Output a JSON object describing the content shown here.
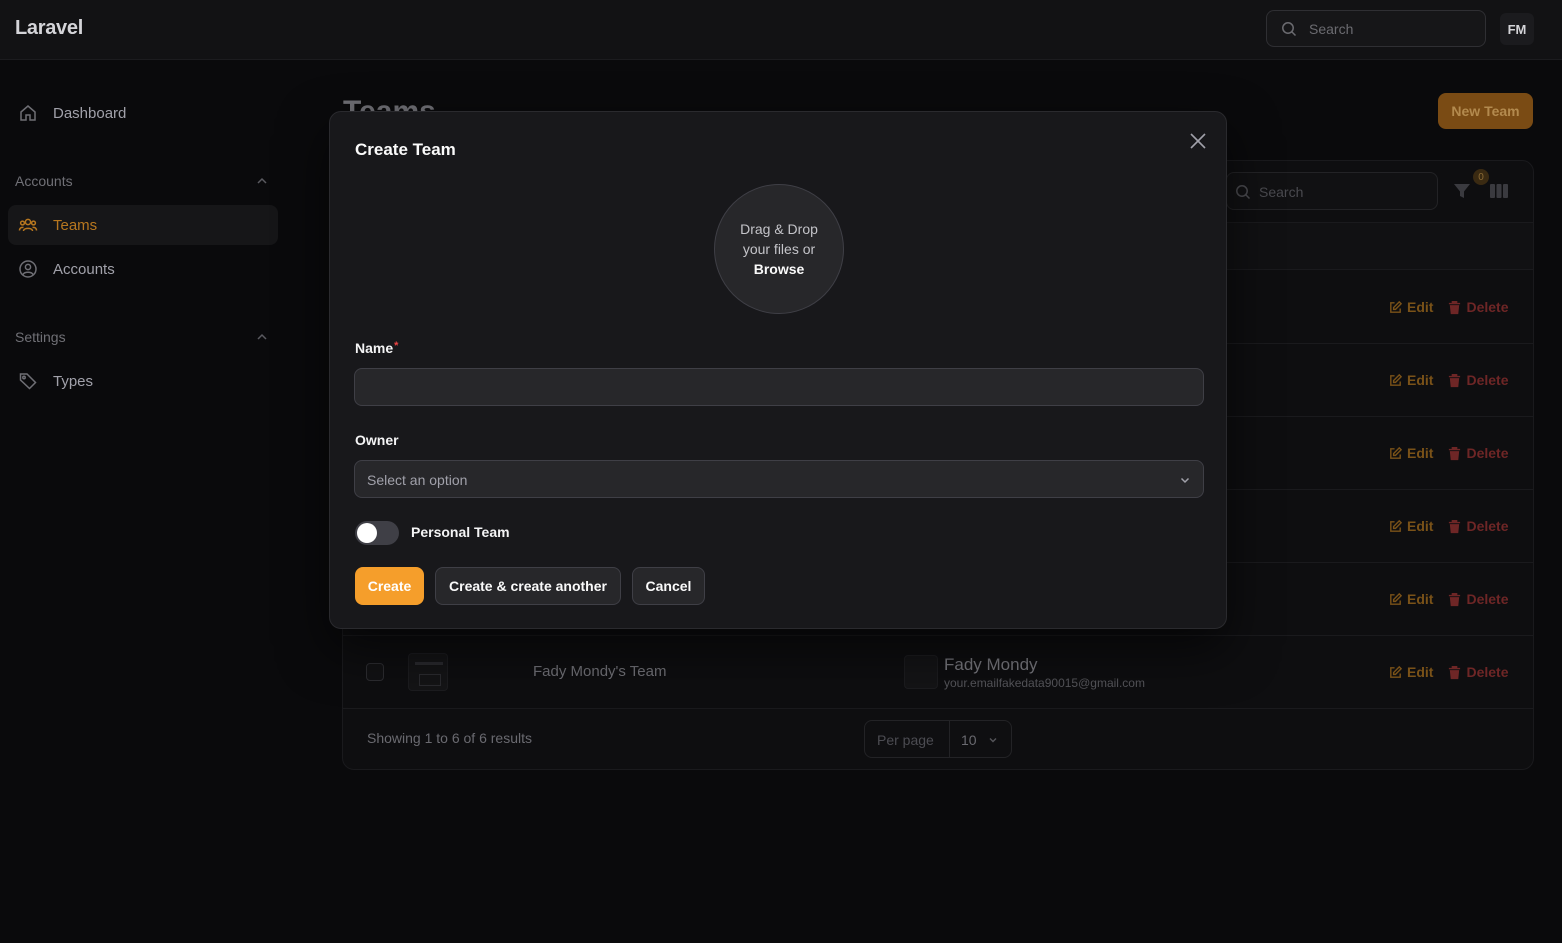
{
  "app": {
    "brand": "Laravel"
  },
  "topbar": {
    "search_placeholder": "Search",
    "avatar_initials": "FM"
  },
  "sidebar": {
    "dashboard": "Dashboard",
    "groups": [
      {
        "label": "Accounts",
        "items": [
          "Teams",
          "Accounts"
        ]
      },
      {
        "label": "Settings",
        "items": [
          "Types"
        ]
      }
    ],
    "active_item": "Teams"
  },
  "page": {
    "title": "Teams",
    "new_button": "New Team",
    "table_search_placeholder": "Search",
    "filter_count": "0",
    "row_actions": {
      "edit": "Edit",
      "delete": "Delete"
    },
    "visible_row": {
      "name": "Fady Mondy's Team",
      "owner_name": "Fady Mondy",
      "owner_email": "your.emailfakedata90015@gmail.com"
    },
    "showing": "Showing 1 to 6 of 6 results",
    "per_page_label": "Per page",
    "per_page_value": "10"
  },
  "modal": {
    "title": "Create Team",
    "dropzone_line1": "Drag & Drop",
    "dropzone_line2": "your files or",
    "dropzone_browse": "Browse",
    "name_label": "Name",
    "name_required_mark": "*",
    "name_value": "",
    "owner_label": "Owner",
    "owner_placeholder": "Select an option",
    "personal_team_label": "Personal Team",
    "personal_team_on": false,
    "buttons": {
      "create": "Create",
      "create_another": "Create & create another",
      "cancel": "Cancel"
    }
  },
  "colors": {
    "accent": "#f59e2b",
    "background": "#0a0a0c",
    "modal_bg": "#18181b",
    "danger": "#ef4444"
  }
}
